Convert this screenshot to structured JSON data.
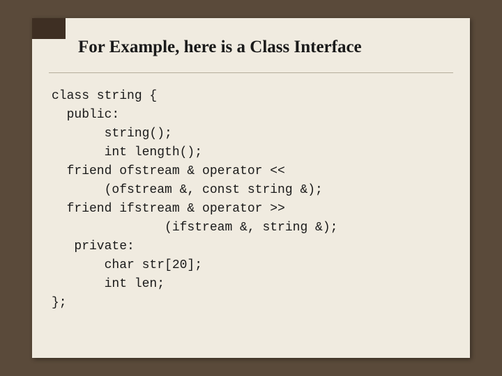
{
  "slide": {
    "title": "For Example, here is a Class Interface",
    "code_lines": [
      "class string {",
      "  public:",
      "       string();",
      "       int length();",
      "  friend ofstream & operator <<",
      "       (ofstream &, const string &);",
      "  friend ifstream & operator >>",
      "               (ifstream &, string &);",
      "   private:",
      "       char str[20];",
      "       int len;",
      "};"
    ]
  }
}
